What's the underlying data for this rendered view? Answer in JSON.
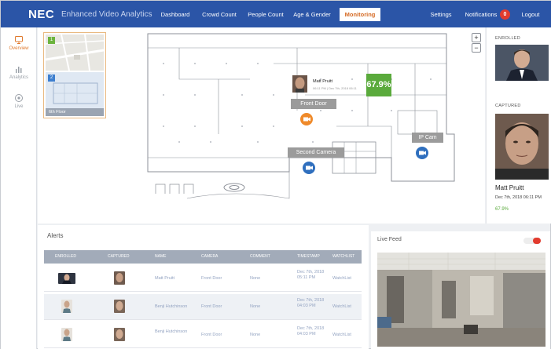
{
  "header": {
    "logo": "NEC",
    "app_title": "Enhanced Video Analytics",
    "nav": [
      "Dashboard",
      "Crowd Count",
      "People Count",
      "Age & Gender",
      "Monitoring"
    ],
    "active_nav": "Monitoring",
    "settings": "Settings",
    "notifications": "Notifications",
    "notification_count": "0",
    "logout": "Logout"
  },
  "sidebar": {
    "items": [
      {
        "label": "Overview",
        "icon": "monitor-icon",
        "active": true
      },
      {
        "label": "Analytics",
        "icon": "bar-chart-icon",
        "active": false
      },
      {
        "label": "Live",
        "icon": "live-icon",
        "active": false
      }
    ]
  },
  "map": {
    "floor_thumbnails": [
      {
        "badge": "1",
        "label": "",
        "badge_color": "#6cb33e"
      },
      {
        "badge": "2",
        "label": "6th Floor",
        "badge_color": "#3e7fcf"
      }
    ],
    "zoom_in": "+",
    "zoom_out": "−",
    "cameras": [
      {
        "name": "Front Door",
        "color": "#ef8a2a"
      },
      {
        "name": "Second Camera",
        "color": "#2f6fbe"
      },
      {
        "name": "IP Cam",
        "color": "#2f6fbe"
      }
    ],
    "popup": {
      "name": "Matt Pruitt",
      "subtitle": "06:11 PM | Dec 7th, 2018 06:11"
    },
    "match_score": "67.9%"
  },
  "right_panel": {
    "enrolled_label": "ENROLLED",
    "captured_label": "CAPTURED",
    "name": "Matt Pruitt",
    "timestamp": "Dec 7th, 2018 06:11 PM",
    "match": "67.9%"
  },
  "alerts": {
    "title": "Alerts",
    "columns": [
      "ENROLLED",
      "CAPTURED",
      "NAME",
      "CAMERA",
      "COMMENT",
      "TIMESTAMP",
      "WATCHLIST"
    ],
    "rows": [
      {
        "name": "Matt Pruitt",
        "camera": "Front Door",
        "comment": "None",
        "timestamp": "Dec 7th, 2018 05:11 PM",
        "watchlist": "WatchList"
      },
      {
        "name": "Benji Hutchinson",
        "camera": "Front Door",
        "comment": "None",
        "timestamp": "Dec 7th, 2018 04:03 PM",
        "watchlist": "WatchList"
      },
      {
        "name": "Benji Hutchinson",
        "camera": "Front Door",
        "comment": "None",
        "timestamp": "Dec 7th, 2018 04:03 PM",
        "watchlist": "WatchList"
      }
    ]
  },
  "live_feed": {
    "title": "Live Feed",
    "toggle_on": true
  },
  "colors": {
    "brand": "#2b55a7",
    "accent": "#e07a2e",
    "success": "#5aaa3c",
    "alert": "#e23b2e"
  }
}
